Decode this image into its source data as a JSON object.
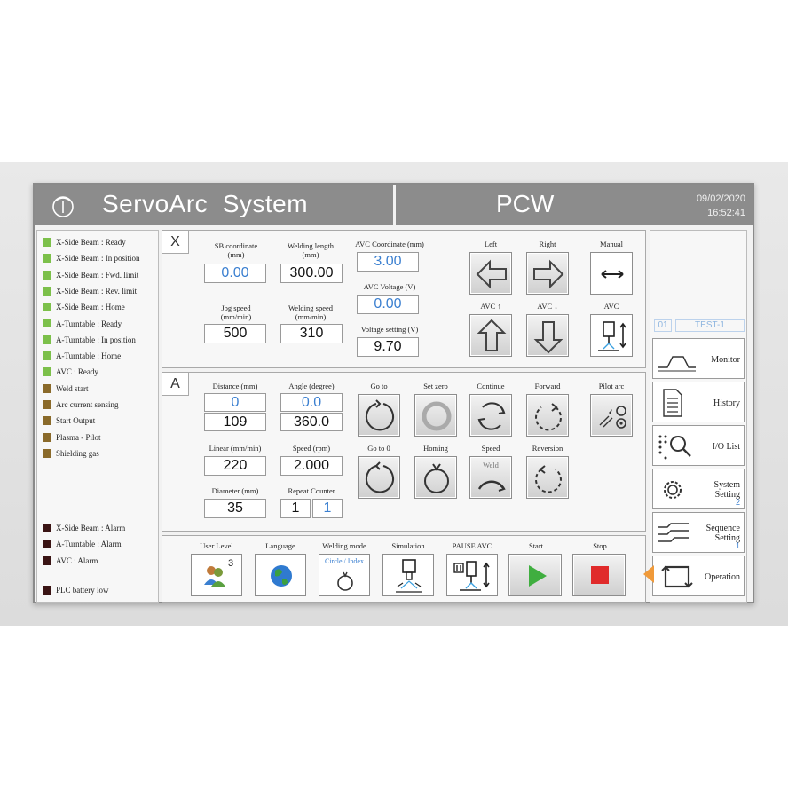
{
  "header": {
    "title": "ServoArc  System",
    "mode": "PCW",
    "date": "09/02/2020",
    "time": "16:52:41"
  },
  "status_group1": [
    {
      "label": "X-Side Beam : Ready",
      "color": "#7cc04a"
    },
    {
      "label": "X-Side Beam : In position",
      "color": "#7cc04a"
    },
    {
      "label": "X-Side Beam : Fwd. limit",
      "color": "#7cc04a"
    },
    {
      "label": "X-Side Beam : Rev. limit",
      "color": "#7cc04a"
    },
    {
      "label": "X-Side Beam : Home",
      "color": "#7cc04a"
    },
    {
      "label": "A-Turntable : Ready",
      "color": "#7cc04a"
    },
    {
      "label": "A-Turntable : In position",
      "color": "#7cc04a"
    },
    {
      "label": "A-Turntable : Home",
      "color": "#7cc04a"
    },
    {
      "label": "AVC : Ready",
      "color": "#7cc04a"
    },
    {
      "label": "Weld start",
      "color": "#8a6a2a"
    },
    {
      "label": "Arc current sensing",
      "color": "#8a6a2a"
    },
    {
      "label": "Start Output",
      "color": "#8a6a2a"
    },
    {
      "label": "Plasma - Pilot",
      "color": "#8a6a2a"
    },
    {
      "label": "Shielding gas",
      "color": "#8a6a2a"
    }
  ],
  "status_group2": [
    {
      "label": "X-Side Beam : Alarm",
      "color": "#3a1414"
    },
    {
      "label": "A-Turntable : Alarm",
      "color": "#3a1414"
    },
    {
      "label": "AVC : Alarm",
      "color": "#3a1414"
    }
  ],
  "status_plc": {
    "label": "PLC battery low",
    "color": "#3a1414"
  },
  "x_panel": {
    "tag": "X",
    "sb_label": "SB coordinate\n(mm)",
    "sb_value": "0.00",
    "wl_label": "Welding length\n(mm)",
    "wl_value": "300.00",
    "avc_coord_label": "AVC Coordinate (mm)",
    "avc_coord_value": "3.00",
    "avc_volt_label": "AVC Voltage (V)",
    "avc_volt_value": "0.00",
    "volt_set_label": "Voltage setting (V)",
    "volt_set_value": "9.70",
    "jog_label": "Jog speed\n(mm/min)",
    "jog_value": "500",
    "ws_label": "Welding speed\n(mm/min)",
    "ws_value": "310",
    "left_label": "Left",
    "right_label": "Right",
    "manual_label": "Manual",
    "avc_up_label": "AVC ↑",
    "avc_down_label": "AVC ↓",
    "avc_label": "AVC"
  },
  "a_panel": {
    "tag": "A",
    "dist_label": "Distance (mm)",
    "dist_value1": "0",
    "dist_value2": "109",
    "angle_label": "Angle (degree)",
    "angle_value1": "0.0",
    "angle_value2": "360.0",
    "linear_label": "Linear (mm/min)",
    "linear_value": "220",
    "speed_label": "Speed (rpm)",
    "speed_value": "2.000",
    "diam_label": "Diameter (mm)",
    "diam_value": "35",
    "repeat_label": "Repeat Counter",
    "repeat_value1": "1",
    "repeat_value2": "1",
    "goto_label": "Go to",
    "setzero_label": "Set zero",
    "continue_label": "Continue",
    "forward_label": "Forward",
    "pilot_label": "Pilot arc",
    "goto0_label": "Go to 0",
    "homing_label": "Homing",
    "speed_btn_label": "Speed",
    "speed_btn_inner": "Weld",
    "reversion_label": "Reversion"
  },
  "bottom": {
    "user_label": "User Level",
    "user_num": "3",
    "lang_label": "Language",
    "mode_label": "Welding mode",
    "mode_inner": "Circle / Index",
    "sim_label": "Simulation",
    "pause_label": "PAUSE AVC",
    "start_label": "Start",
    "stop_label": "Stop"
  },
  "nav": {
    "prog_no": "01",
    "prog_name": "TEST-1",
    "monitor": "Monitor",
    "history": "History",
    "io": "I/O List",
    "system": "System\nSetting",
    "system_sub": "2",
    "sequence": "Sequence\nSetting",
    "sequence_sub": "1",
    "operation": "Operation"
  },
  "colors": {
    "header_bg": "#8c8c8c",
    "accent_blue": "#3a7fd0",
    "start_green": "#3fae3f",
    "stop_red": "#e02a2a",
    "indicator_orange": "#f09a3a"
  }
}
